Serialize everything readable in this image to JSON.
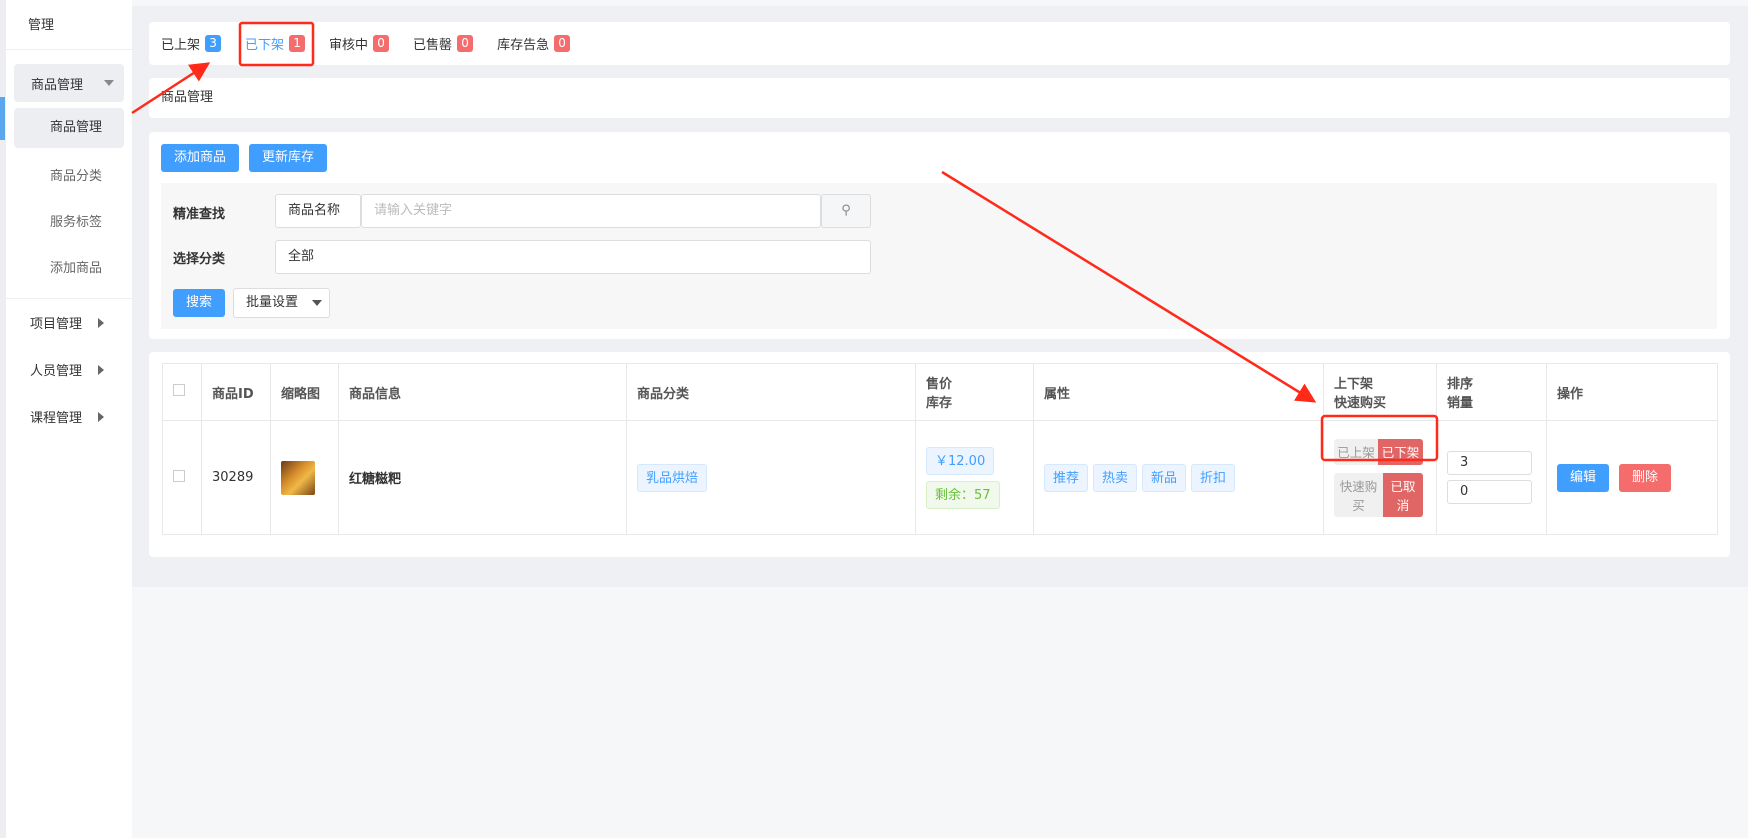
{
  "sidebar": {
    "title": "管理",
    "group": "商品管理",
    "items": [
      "商品管理",
      "商品分类",
      "服务标签",
      "添加商品"
    ],
    "menus": [
      "项目管理",
      "人员管理",
      "课程管理"
    ]
  },
  "tabs": [
    {
      "label": "已上架",
      "count": "3",
      "color": "#409eff"
    },
    {
      "label": "已下架",
      "count": "1",
      "color": "#f56c6c"
    },
    {
      "label": "审核中",
      "count": "0",
      "color": "#f56c6c"
    },
    {
      "label": "已售罄",
      "count": "0",
      "color": "#f56c6c"
    },
    {
      "label": "库存告急",
      "count": "0",
      "color": "#f56c6c"
    }
  ],
  "breadcrumb": "商品管理",
  "toolbar": {
    "add": "添加商品",
    "update_stock": "更新库存"
  },
  "filter": {
    "exact_label": "精准查找",
    "field_select": "商品名称",
    "keyword_placeholder": "请输入关键字",
    "category_label": "选择分类",
    "category_value": "全部",
    "search": "搜索",
    "batch": "批量设置"
  },
  "table": {
    "headers": {
      "id": "商品ID",
      "thumb": "缩略图",
      "info": "商品信息",
      "category": "商品分类",
      "price1": "售价",
      "price2": "库存",
      "attr": "属性",
      "shelf1": "上下架",
      "shelf2": "快速购买",
      "sort1": "排序",
      "sort2": "销量",
      "ops": "操作"
    },
    "rows": [
      {
        "id": "30289",
        "name": "红糖糍粑",
        "category": "乳品烘焙",
        "price": "￥12.00",
        "stock": "剩余：57",
        "attrs": [
          "推荐",
          "热卖",
          "新品",
          "折扣"
        ],
        "shelf_on": "已上架",
        "shelf_off": "已下架",
        "quick_buy": "快速购买",
        "quick_cancel": "已取消",
        "sort": "3",
        "sales": "0",
        "edit": "编辑",
        "delete": "删除"
      }
    ]
  },
  "colors": {
    "primary": "#409eff",
    "danger": "#f56c6c",
    "switch_active": "#e06666",
    "annotation": "#ff2a1a"
  }
}
